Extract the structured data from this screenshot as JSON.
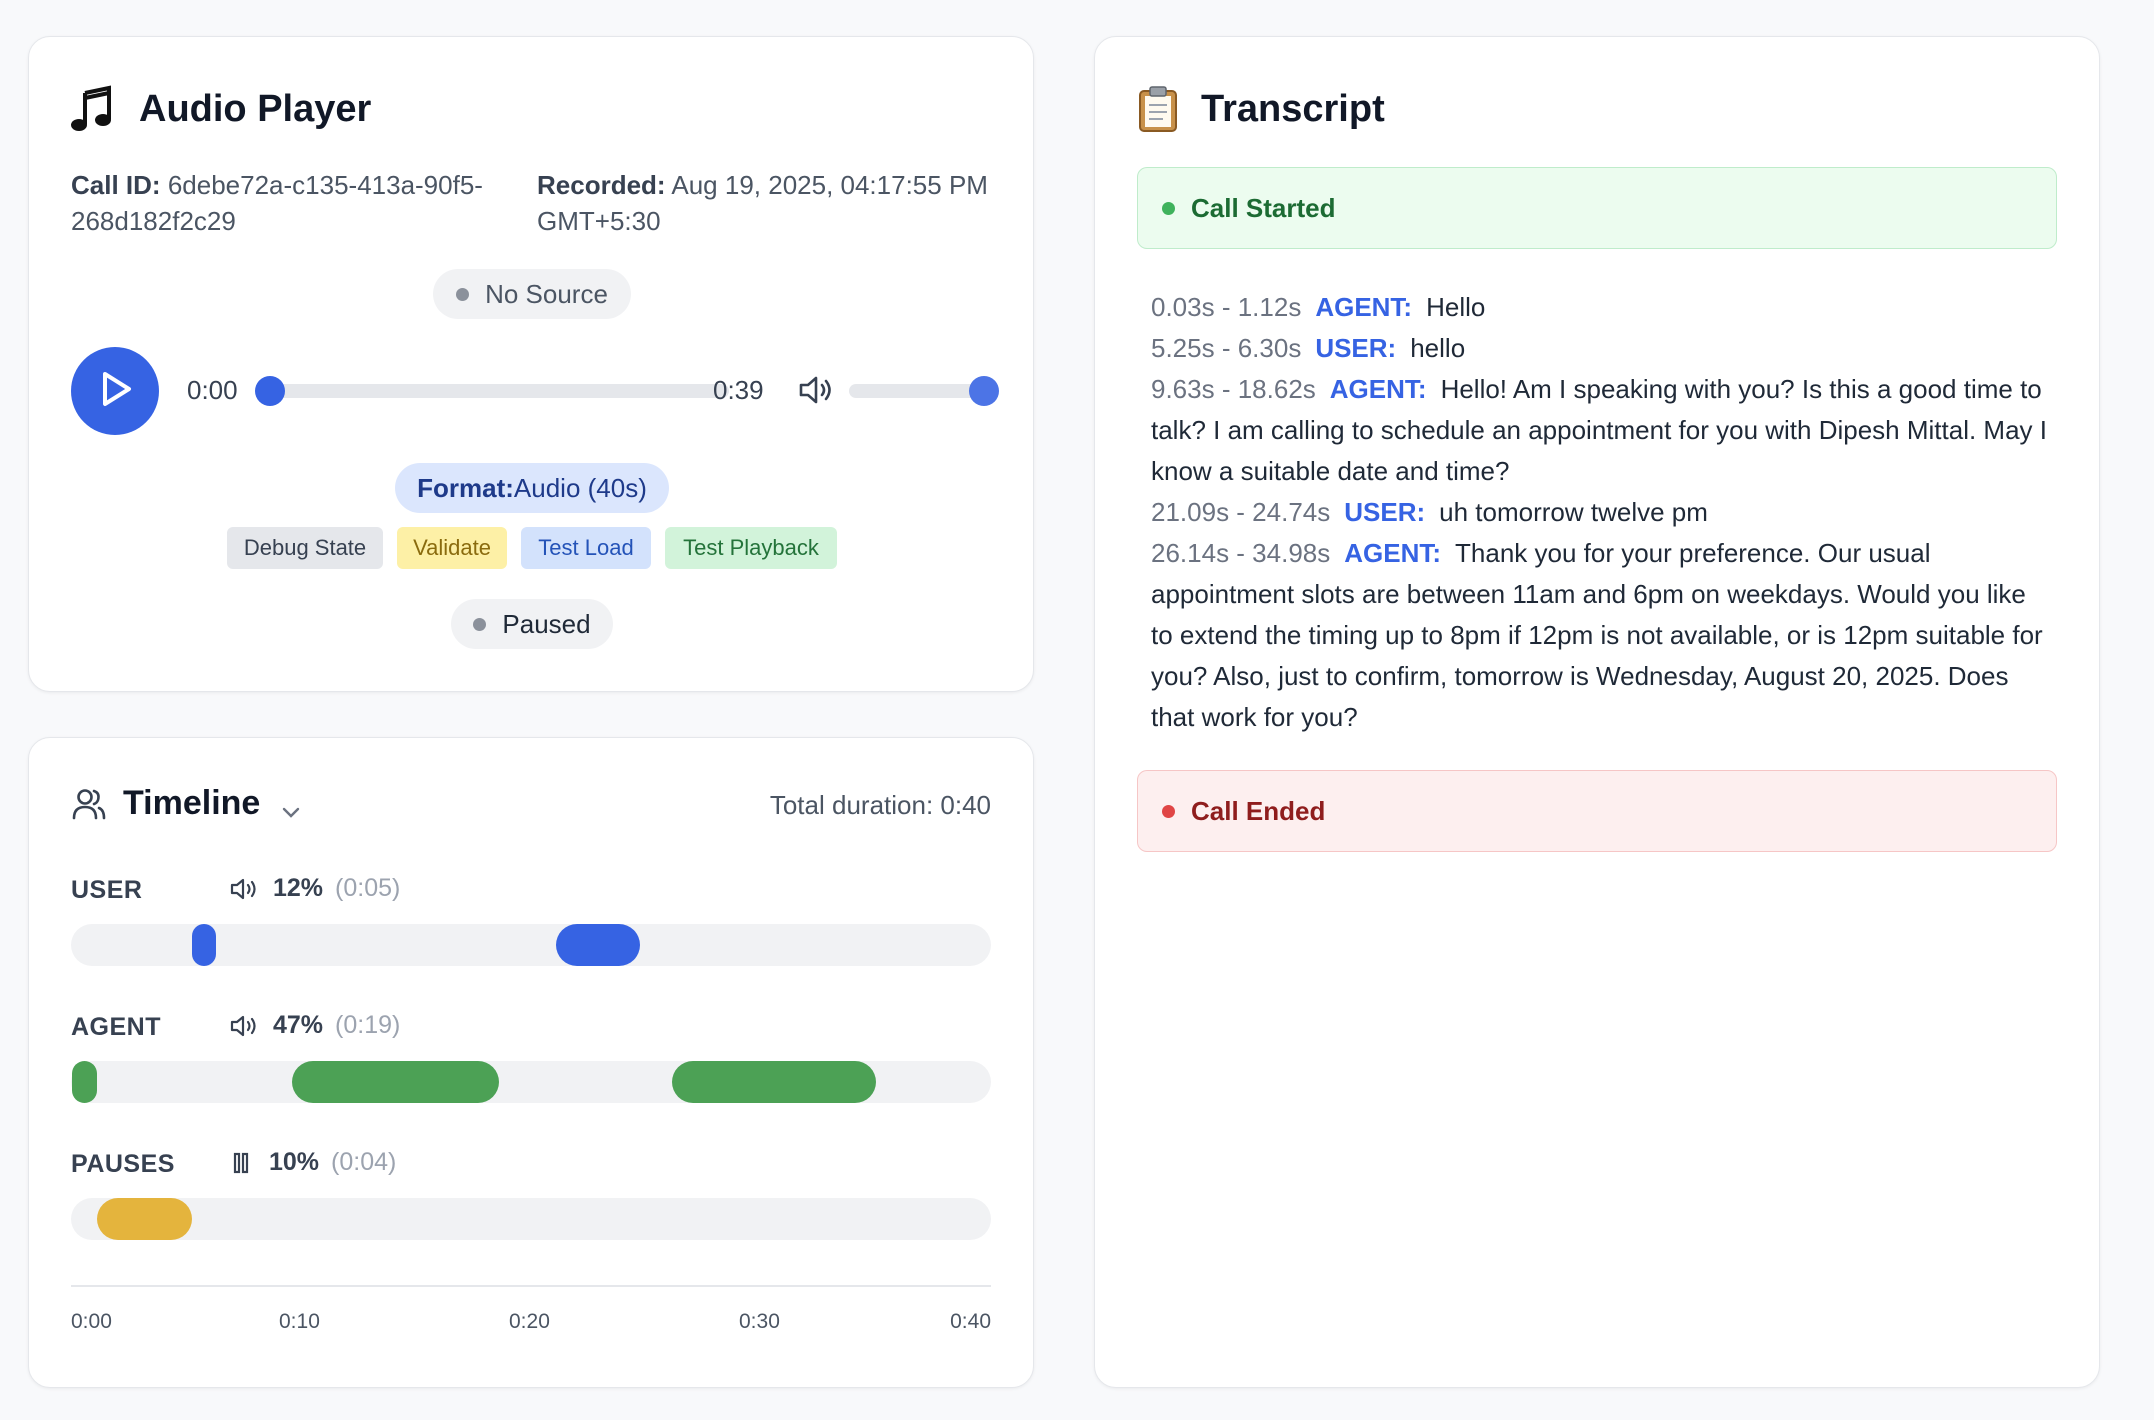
{
  "audio_player": {
    "title": "Audio Player",
    "title_icon": "music-note-icon",
    "call_id_label": "Call ID:",
    "call_id_line1": "6debe72a-c135-413a-90f5-",
    "call_id_line2": "268d182f2c29",
    "recorded_label": "Recorded:",
    "recorded_line1": "Aug 19, 2025, 04:17:55 PM",
    "recorded_line2": "GMT+5:30",
    "source_status": "No Source",
    "current_time": "0:00",
    "total_time": "0:39",
    "progress": 0.0,
    "volume": 1.0,
    "format_label": "Format:",
    "format_value": "Audio (40s)",
    "buttons": {
      "debug": "Debug State",
      "validate": "Validate",
      "test_load": "Test Load",
      "test_playback": "Test Playback"
    },
    "playback_status": "Paused"
  },
  "timeline": {
    "title": "Timeline",
    "total_duration": "Total duration: 0:40",
    "total_seconds": 40,
    "tracks": [
      {
        "name": "USER",
        "icon": "speaker-icon",
        "percent": "12%",
        "duration": "(0:05)",
        "color": "#3663e3",
        "segments": [
          [
            5.25,
            6.3
          ],
          [
            21.09,
            24.74
          ]
        ]
      },
      {
        "name": "AGENT",
        "icon": "speaker-icon",
        "percent": "47%",
        "duration": "(0:19)",
        "color": "#4ca155",
        "segments": [
          [
            0.03,
            1.12
          ],
          [
            9.63,
            18.62
          ],
          [
            26.14,
            34.98
          ]
        ]
      },
      {
        "name": "PAUSES",
        "icon": "pause-icon",
        "percent": "10%",
        "duration": "(0:04)",
        "color": "#e4b43d",
        "segments": [
          [
            1.12,
            5.25
          ]
        ]
      }
    ],
    "axis_ticks": [
      "0:00",
      "0:10",
      "0:20",
      "0:30",
      "0:40"
    ]
  },
  "transcript": {
    "title": "Transcript",
    "title_icon": "clipboard-icon",
    "start_event": "Call Started",
    "end_event": "Call Ended",
    "entries": [
      {
        "time": "0.03s - 1.12s",
        "speaker": "AGENT:",
        "text": "Hello"
      },
      {
        "time": "5.25s - 6.30s",
        "speaker": "USER:",
        "text": "hello"
      },
      {
        "time": "9.63s - 18.62s",
        "speaker": "AGENT:",
        "text": "Hello! Am I speaking with you? Is this a good time to talk? I am calling to schedule an appointment for you with Dipesh Mittal. May I know a suitable date and time?"
      },
      {
        "time": "21.09s - 24.74s",
        "speaker": "USER:",
        "text": "uh tomorrow twelve pm"
      },
      {
        "time": "26.14s - 34.98s",
        "speaker": "AGENT:",
        "text": "Thank you for your preference. Our usual appointment slots are between 11am and 6pm on weekdays. Would you like to extend the timing up to 8pm if 12pm is not available, or is 12pm suitable for you? Also, just to confirm, tomorrow is Wednesday, August 20, 2025. Does that work for you?"
      }
    ]
  }
}
